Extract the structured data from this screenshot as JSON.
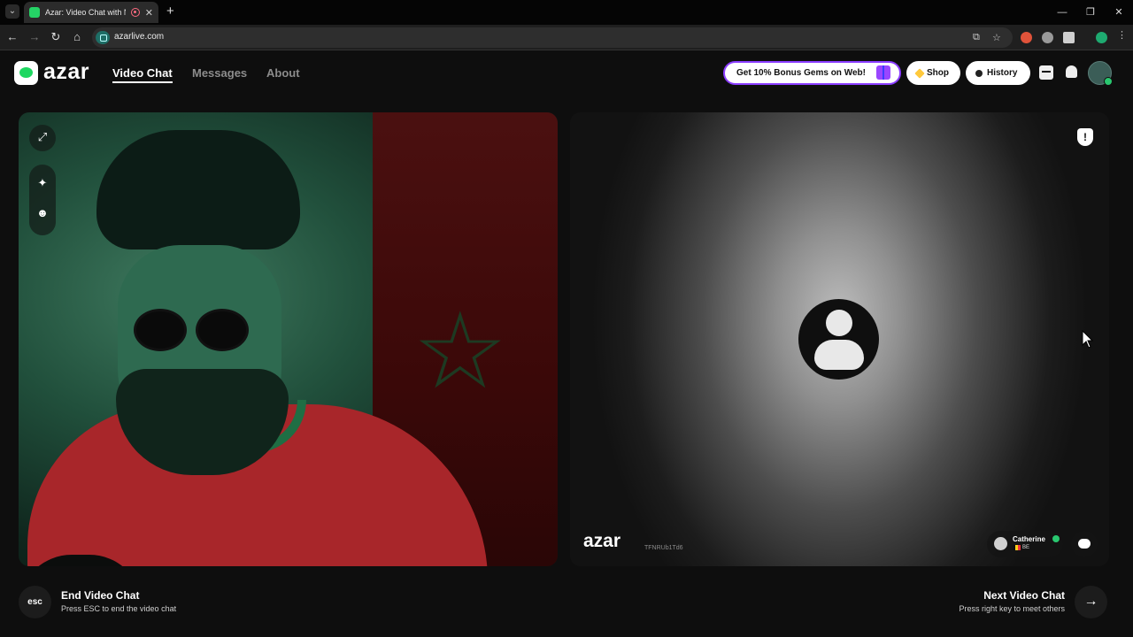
{
  "browser": {
    "tab_title": "Azar: Video Chat with New",
    "url": "azarlive.com",
    "new_tab": "+",
    "tab_close": "✕",
    "win_min": "—",
    "win_restore": "❐",
    "win_close": "✕"
  },
  "header": {
    "logo": "azar",
    "nav": [
      {
        "label": "Video Chat",
        "active": true
      },
      {
        "label": "Messages",
        "active": false
      },
      {
        "label": "About",
        "active": false
      }
    ],
    "promo": "Get 10% Bonus Gems on Web!",
    "shop": "Shop",
    "history": "History"
  },
  "remote": {
    "watermark": "azar",
    "session_id": "TFNRUb1Td6",
    "peer_name": "Catherine",
    "peer_country": "BE",
    "report_glyph": "!"
  },
  "footer": {
    "esc_label": "esc",
    "end_title": "End Video Chat",
    "end_sub": "Press ESC to end the video chat",
    "next_title": "Next Video Chat",
    "next_sub": "Press right key to meet others",
    "next_arrow": "→"
  },
  "icons": {
    "expand": "⤢",
    "magic": "✦",
    "sticker": "☻"
  },
  "colors": {
    "accent_green": "#1ed760",
    "promo_border": "#8a3cff",
    "gem_yellow": "#ffc93c",
    "background": "#0e0e0e"
  }
}
